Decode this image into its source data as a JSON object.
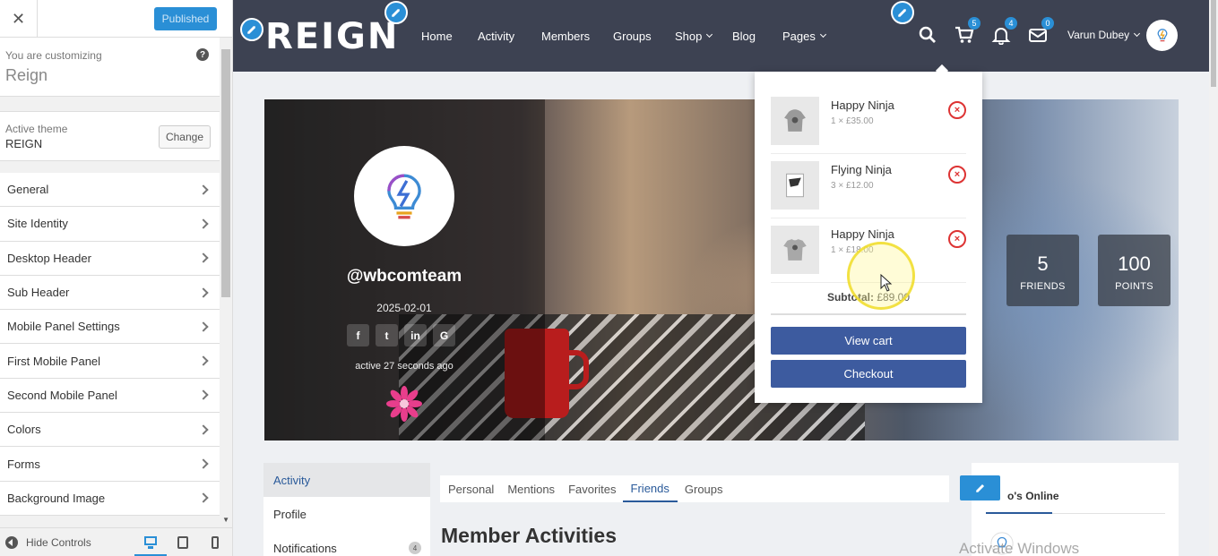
{
  "customizer": {
    "publish_label": "Published",
    "info_small": "You are customizing",
    "info_big": "Reign",
    "help_label": "?",
    "theme_small": "Active theme",
    "theme_name": "REIGN",
    "change_label": "Change",
    "sections": [
      {
        "label": "General"
      },
      {
        "label": "Site Identity"
      },
      {
        "label": "Desktop Header"
      },
      {
        "label": "Sub Header"
      },
      {
        "label": "Mobile Panel Settings"
      },
      {
        "label": "First Mobile Panel"
      },
      {
        "label": "Second Mobile Panel"
      },
      {
        "label": "Colors"
      },
      {
        "label": "Forms"
      },
      {
        "label": "Background Image"
      }
    ],
    "hide_controls_label": "Hide Controls"
  },
  "header": {
    "logo_text": "REIGN",
    "nav": [
      {
        "label": "Home"
      },
      {
        "label": "Activity"
      },
      {
        "label": "Members"
      },
      {
        "label": "Groups"
      },
      {
        "label": "Shop",
        "dropdown": true
      },
      {
        "label": "Blog"
      },
      {
        "label": "Pages",
        "dropdown": true
      }
    ],
    "cart_count": "5",
    "notifications_count": "4",
    "messages_count": "0",
    "user_name": "Varun Dubey"
  },
  "profile": {
    "handle": "@wbcomteam",
    "date": "2025-02-01",
    "socials": [
      "f",
      "t",
      "in",
      "G"
    ],
    "active_text": "active 27 seconds ago",
    "stats": [
      {
        "value": "5",
        "label": "FRIENDS"
      },
      {
        "value": "100",
        "label": "POINTS"
      }
    ]
  },
  "mini_cart": {
    "items": [
      {
        "name": "Happy Ninja",
        "meta": "1 × £35.00"
      },
      {
        "name": "Flying Ninja",
        "meta": "3 × £12.00"
      },
      {
        "name": "Happy Ninja",
        "meta": "1 × £18.00"
      }
    ],
    "remove_symbol": "×",
    "subtotal_label": "Subtotal:",
    "subtotal_value": "£89.00",
    "view_cart_label": "View cart",
    "checkout_label": "Checkout"
  },
  "content": {
    "left_menu": [
      {
        "label": "Activity",
        "active": true
      },
      {
        "label": "Profile"
      },
      {
        "label": "Notifications",
        "count": "4"
      }
    ],
    "subtabs": [
      {
        "label": "Personal"
      },
      {
        "label": "Mentions"
      },
      {
        "label": "Favorites"
      },
      {
        "label": "Friends",
        "active": true
      },
      {
        "label": "Groups"
      }
    ],
    "title": "Member Activities",
    "online_title": "o's Online",
    "watermark": "Activate Windows"
  },
  "colors": {
    "accent": "#2a8fd6",
    "header_bg": "#3d4252",
    "button": "#3d5b9f",
    "remove": "#dd3333"
  }
}
